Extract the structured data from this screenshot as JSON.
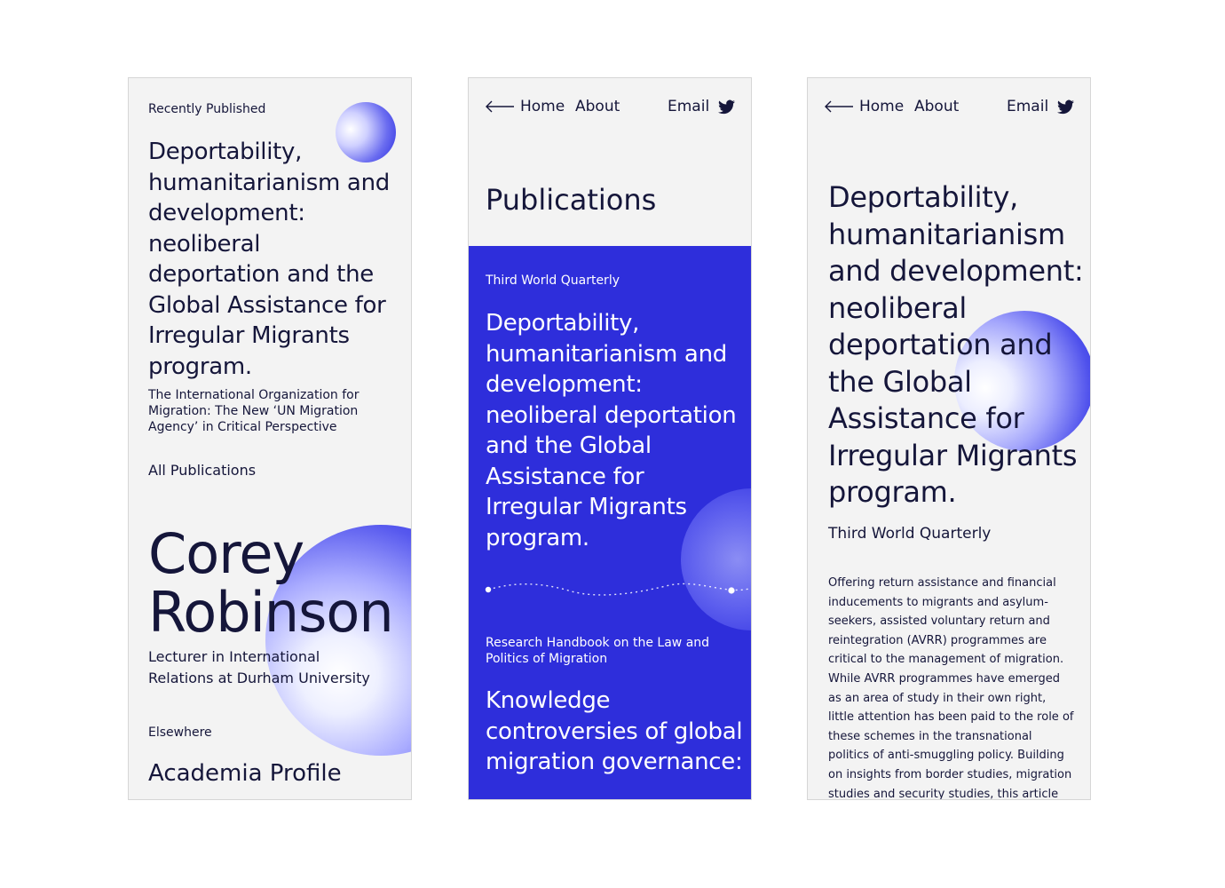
{
  "profile_screen": {
    "recent_label": "Recently Published",
    "featured_title": "Deportability, humanitarianism and development: neoliberal deportation and the Global Assistance for Irregular Migrants program.",
    "second_publication": "The International Organization for Migration: The New ‘UN Migration Agency’ in Critical Perspective",
    "all_publications": "All Publications",
    "name": "Corey Robinson",
    "role": "Lecturer in International Relations at Durham University",
    "elsewhere_label": "Elsewhere",
    "academia_link": "Academia Profile"
  },
  "nav": {
    "back_icon": "arrow-left-icon",
    "home": "Home",
    "about": "About",
    "email": "Email",
    "social_icon": "twitter-icon"
  },
  "publications_screen": {
    "page_title": "Publications",
    "items": [
      {
        "journal": "Third World Quarterly",
        "title": "Deportability, humanitarianism and development: neoliberal deportation and the Global Assistance for Irregular Migrants program."
      },
      {
        "journal": "Research Handbook on the Law and Politics of Migration",
        "title": "Knowledge controversies of global migration governance:"
      }
    ]
  },
  "article_screen": {
    "title": "Deportability, humanitarianism and development: neoliberal deportation and the Global Assistance for Irregular Migrants program.",
    "journal": "Third World Quarterly",
    "abstract": "Offering return assistance and financial inducements to migrants and asylum-seekers, assisted voluntary return and reintegration (AVRR) programmes are critical to the management of migration. While AVRR programmes have emerged as an area of study in their own right, little attention has been paid to the role of these schemes in the transnational politics of anti-smuggling policy. Building on insights from border studies, migration studies and security studies, this article examines the"
  },
  "colors": {
    "accent": "#2e2edb",
    "text": "#15163a",
    "screen_bg": "#f3f3f3"
  }
}
